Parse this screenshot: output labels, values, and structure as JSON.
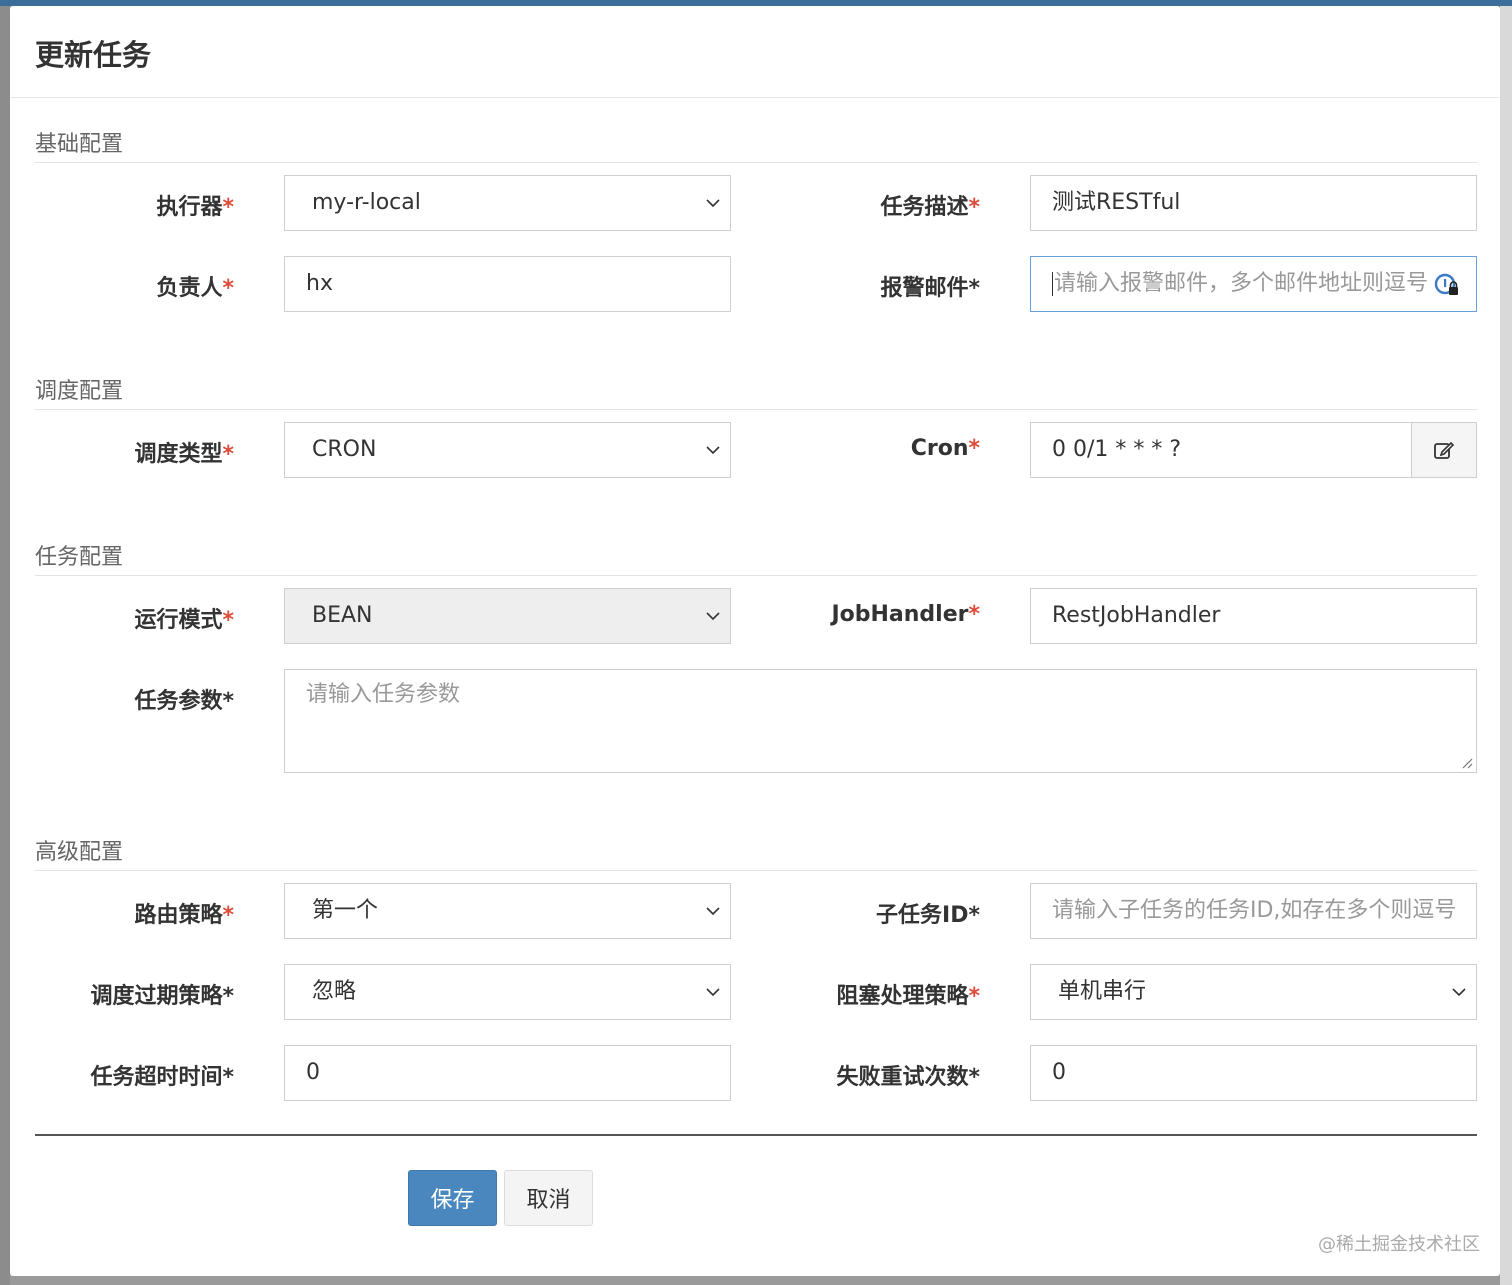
{
  "title": "更新任务",
  "sections": {
    "basic": "基础配置",
    "schedule": "调度配置",
    "task": "任务配置",
    "advanced": "高级配置"
  },
  "required_mark": "*",
  "fields": {
    "executor": {
      "label": "执行器",
      "value": "my-r-local"
    },
    "job_desc": {
      "label": "任务描述",
      "value": "测试RESTful"
    },
    "author": {
      "label": "负责人",
      "value": "hx"
    },
    "alarm_email": {
      "label": "报警邮件",
      "placeholder": "请输入报警邮件，多个邮件地址则逗号"
    },
    "schedule_type": {
      "label": "调度类型",
      "value": "CRON"
    },
    "cron": {
      "label": "Cron",
      "value": "0 0/1 * * * ?"
    },
    "glue_type": {
      "label": "运行模式",
      "value": "BEAN"
    },
    "job_handler": {
      "label": "JobHandler",
      "value": "RestJobHandler"
    },
    "job_param": {
      "label": "任务参数",
      "placeholder": "请输入任务参数"
    },
    "route_strategy": {
      "label": "路由策略",
      "value": "第一个"
    },
    "child_job_id": {
      "label": "子任务ID",
      "placeholder": "请输入子任务的任务ID,如存在多个则逗号"
    },
    "misfire_strategy": {
      "label": "调度过期策略",
      "value": "忽略"
    },
    "block_strategy": {
      "label": "阻塞处理策略",
      "value": "单机串行"
    },
    "timeout": {
      "label": "任务超时时间",
      "value": "0"
    },
    "fail_retry": {
      "label": "失败重试次数",
      "value": "0"
    }
  },
  "buttons": {
    "save": "保存",
    "cancel": "取消"
  },
  "watermark": "@稀土掘金技术社区",
  "colors": {
    "primary": "#4a87be",
    "required": "#dd4b39",
    "header_bar": "#3c6e9c"
  }
}
